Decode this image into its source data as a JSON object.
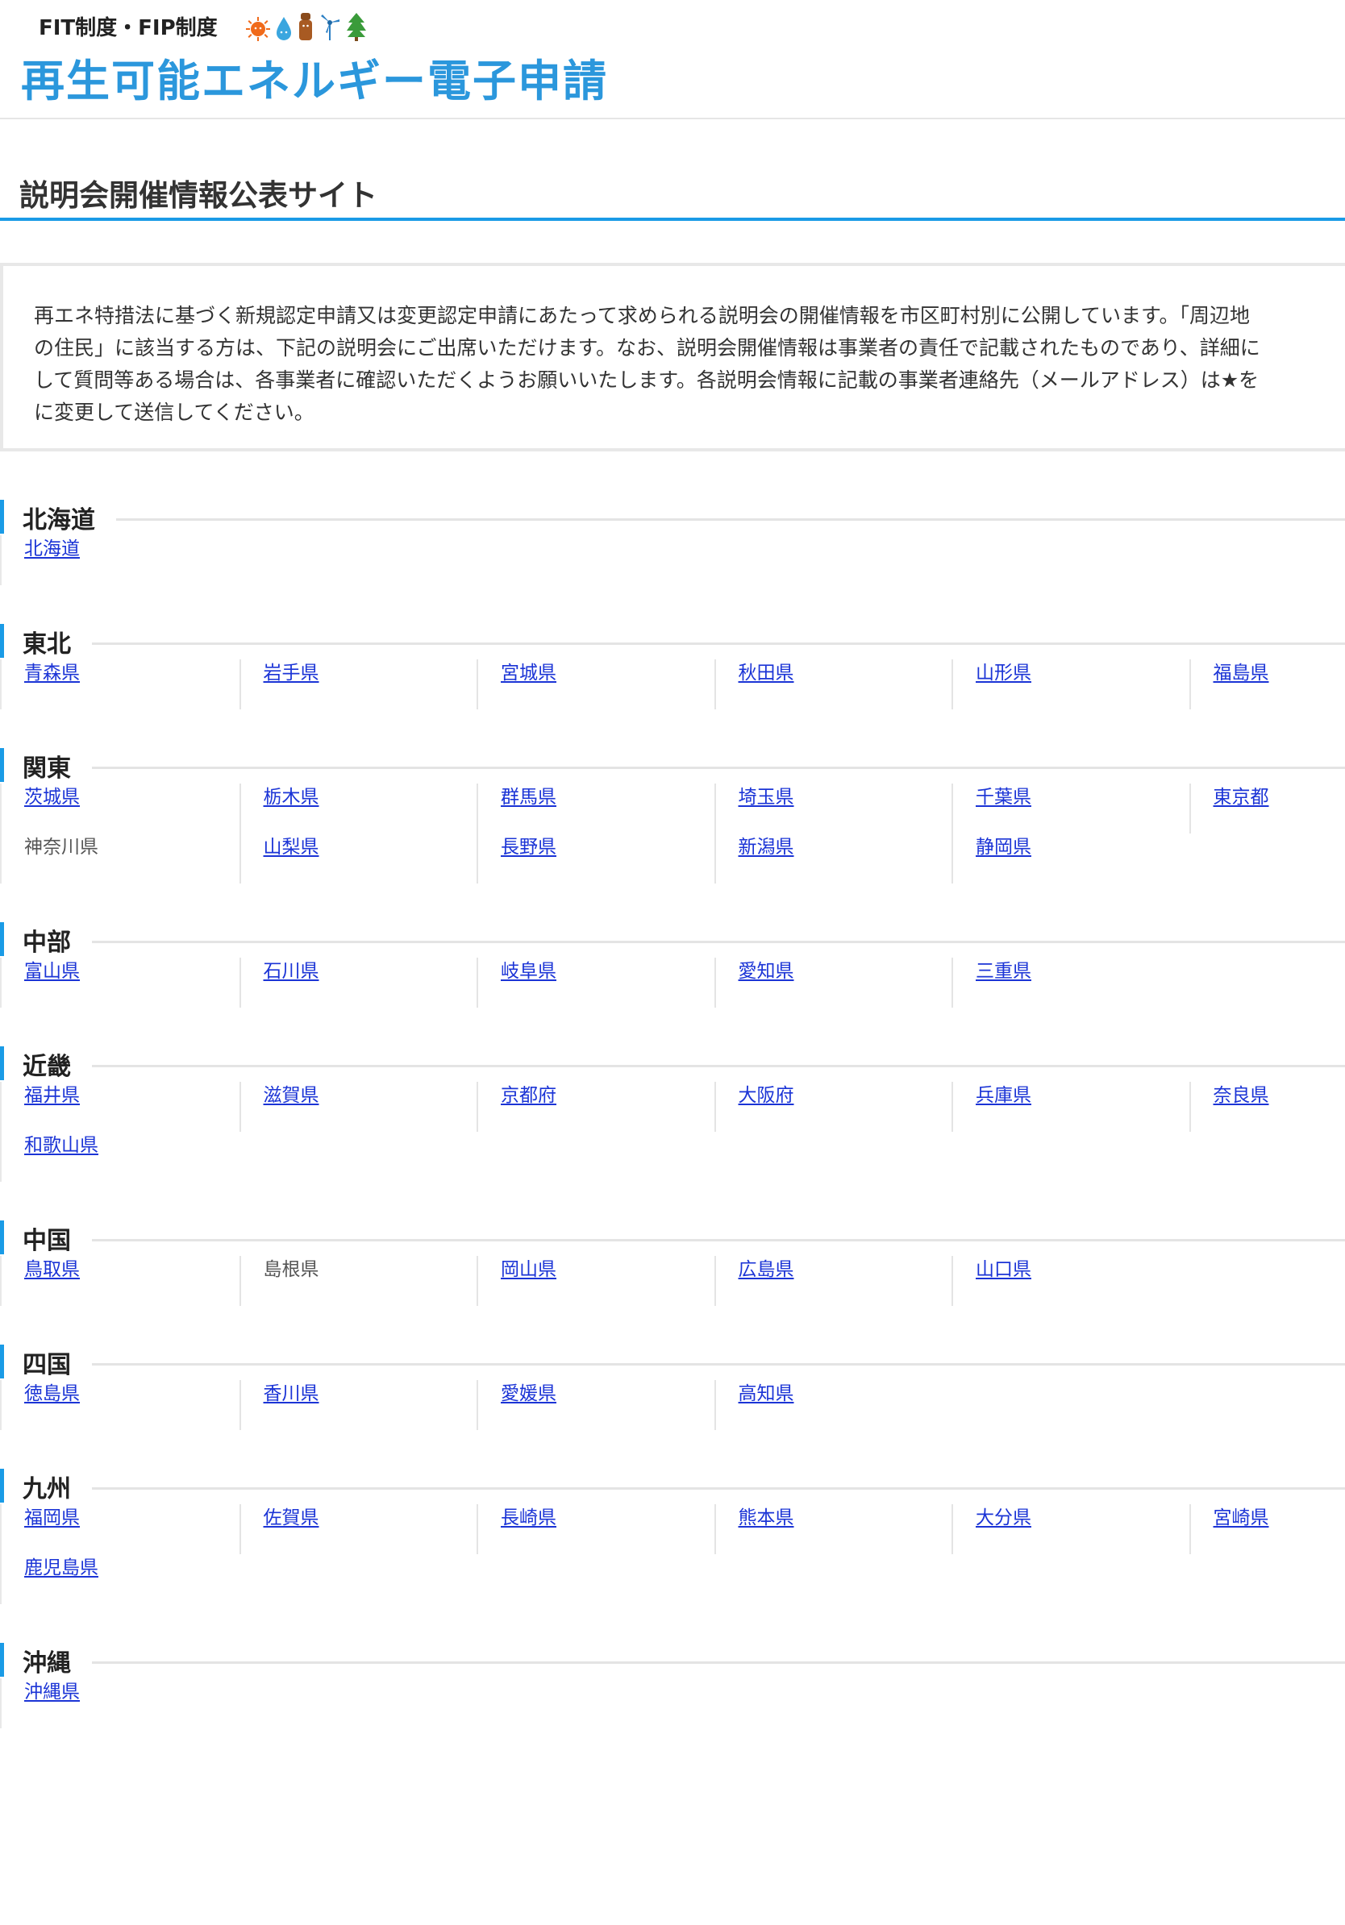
{
  "header": {
    "sub_label": "FIT制度・FIP制度",
    "title": "再生可能エネルギー電子申請",
    "mascot_icons": [
      "sun-mascot-icon",
      "water-drop-mascot-icon",
      "wood-mascot-icon",
      "wind-mascot-icon",
      "tree-mascot-icon"
    ]
  },
  "page": {
    "title": "説明会開催情報公表サイト"
  },
  "notice": {
    "lines": [
      "再エネ特措法に基づく新規認定申請又は変更認定申請にあたって求められる説明会の開催情報を市区町村別に公開しています。「周辺地",
      "の住民」に該当する方は、下記の説明会にご出席いただけます。なお、説明会開催情報は事業者の責任で記載されたものであり、詳細に",
      "して質問等ある場合は、各事業者に確認いただくようお願いいたします。各説明会情報に記載の事業者連絡先（メールアドレス）は★を",
      "に変更して送信してください。"
    ]
  },
  "colors": {
    "brand_blue": "#2b97dc",
    "accent_blue": "#1a9be6",
    "link": "#1b34d6"
  },
  "regions": [
    {
      "name": "北海道",
      "prefectures": [
        {
          "label": "北海道",
          "link": true
        }
      ]
    },
    {
      "name": "東北",
      "prefectures": [
        {
          "label": "青森県",
          "link": true
        },
        {
          "label": "岩手県",
          "link": true
        },
        {
          "label": "宮城県",
          "link": true
        },
        {
          "label": "秋田県",
          "link": true
        },
        {
          "label": "山形県",
          "link": true
        },
        {
          "label": "福島県",
          "link": true
        }
      ]
    },
    {
      "name": "関東",
      "prefectures": [
        {
          "label": "茨城県",
          "link": true
        },
        {
          "label": "栃木県",
          "link": true
        },
        {
          "label": "群馬県",
          "link": true
        },
        {
          "label": "埼玉県",
          "link": true
        },
        {
          "label": "千葉県",
          "link": true
        },
        {
          "label": "東京都",
          "link": true
        },
        {
          "label": "神奈川県",
          "link": false
        },
        {
          "label": "山梨県",
          "link": true
        },
        {
          "label": "長野県",
          "link": true
        },
        {
          "label": "新潟県",
          "link": true
        },
        {
          "label": "静岡県",
          "link": true
        }
      ]
    },
    {
      "name": "中部",
      "prefectures": [
        {
          "label": "富山県",
          "link": true
        },
        {
          "label": "石川県",
          "link": true
        },
        {
          "label": "岐阜県",
          "link": true
        },
        {
          "label": "愛知県",
          "link": true
        },
        {
          "label": "三重県",
          "link": true
        }
      ]
    },
    {
      "name": "近畿",
      "prefectures": [
        {
          "label": "福井県",
          "link": true
        },
        {
          "label": "滋賀県",
          "link": true
        },
        {
          "label": "京都府",
          "link": true
        },
        {
          "label": "大阪府",
          "link": true
        },
        {
          "label": "兵庫県",
          "link": true
        },
        {
          "label": "奈良県",
          "link": true
        },
        {
          "label": "和歌山県",
          "link": true
        }
      ]
    },
    {
      "name": "中国",
      "prefectures": [
        {
          "label": "鳥取県",
          "link": true
        },
        {
          "label": "島根県",
          "link": false
        },
        {
          "label": "岡山県",
          "link": true
        },
        {
          "label": "広島県",
          "link": true
        },
        {
          "label": "山口県",
          "link": true
        }
      ]
    },
    {
      "name": "四国",
      "prefectures": [
        {
          "label": "徳島県",
          "link": true
        },
        {
          "label": "香川県",
          "link": true
        },
        {
          "label": "愛媛県",
          "link": true
        },
        {
          "label": "高知県",
          "link": true
        }
      ]
    },
    {
      "name": "九州",
      "prefectures": [
        {
          "label": "福岡県",
          "link": true
        },
        {
          "label": "佐賀県",
          "link": true
        },
        {
          "label": "長崎県",
          "link": true
        },
        {
          "label": "熊本県",
          "link": true
        },
        {
          "label": "大分県",
          "link": true
        },
        {
          "label": "宮崎県",
          "link": true
        },
        {
          "label": "鹿児島県",
          "link": true
        }
      ]
    },
    {
      "name": "沖縄",
      "prefectures": [
        {
          "label": "沖縄県",
          "link": true
        }
      ]
    }
  ]
}
